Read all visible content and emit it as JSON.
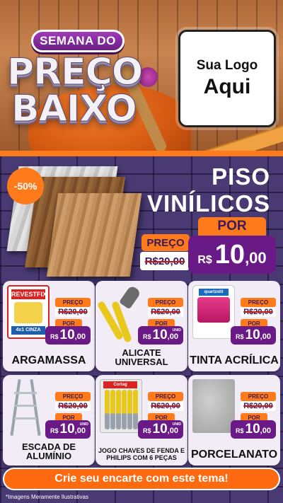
{
  "header": {
    "promo_tag": "SEMANA DO",
    "promo_word_1": "PREÇO",
    "promo_word_2": "BAIXO",
    "logo_line_1": "Sua Logo",
    "logo_line_2": "Aqui"
  },
  "featured": {
    "discount_badge": "-50%",
    "title_line_1": "PISO",
    "title_line_2": "VINÍLICOS",
    "por_label": "POR",
    "preco_label": "PREÇO",
    "old_price": "R$20,00",
    "currency": "R$",
    "new_price_int": "10",
    "new_price_dec": ",00"
  },
  "product_labels": {
    "preco": "PREÇO",
    "por": "POR",
    "currency": "R$",
    "unit": "UNID"
  },
  "products": [
    {
      "name": "ARGAMASSA",
      "old_price": "R$20,00",
      "price_int": "10",
      "price_dec": ",00",
      "unit": "",
      "image_text_1": "REVESTFIX",
      "image_text_2": "4x1 CINZA"
    },
    {
      "name": "ALICATE UNIVERSAL",
      "old_price": "R$20,00",
      "price_int": "10",
      "price_dec": ",00",
      "unit": "UNID"
    },
    {
      "name": "TINTA ACRÍLICA",
      "old_price": "R$20,00",
      "price_int": "10",
      "price_dec": ",00",
      "unit": "",
      "image_text_1": "quartzolit"
    },
    {
      "name": "ESCADA DE ALUMÍNIO",
      "old_price": "R$20,00",
      "price_int": "10",
      "price_dec": ",00",
      "unit": "UNID"
    },
    {
      "name": "JOGO CHAVES DE FENDA E PHILIPS COM 6 PEÇAS",
      "old_price": "R$20,00",
      "price_int": "10",
      "price_dec": ",00",
      "unit": "UNID",
      "image_text_1": "Cortag"
    },
    {
      "name": "PORCELANATO",
      "old_price": "R$20,00",
      "price_int": "10",
      "price_dec": ",00",
      "unit": ""
    }
  ],
  "footer": {
    "cta": "Crie seu encarte com este tema!",
    "disclaimer": "*Imagens Meramente Ilustrativas"
  },
  "colors": {
    "accent_orange": "#ff7a1a",
    "price_purple": "#6a1a86",
    "brick_purple": "#4a3a74"
  }
}
